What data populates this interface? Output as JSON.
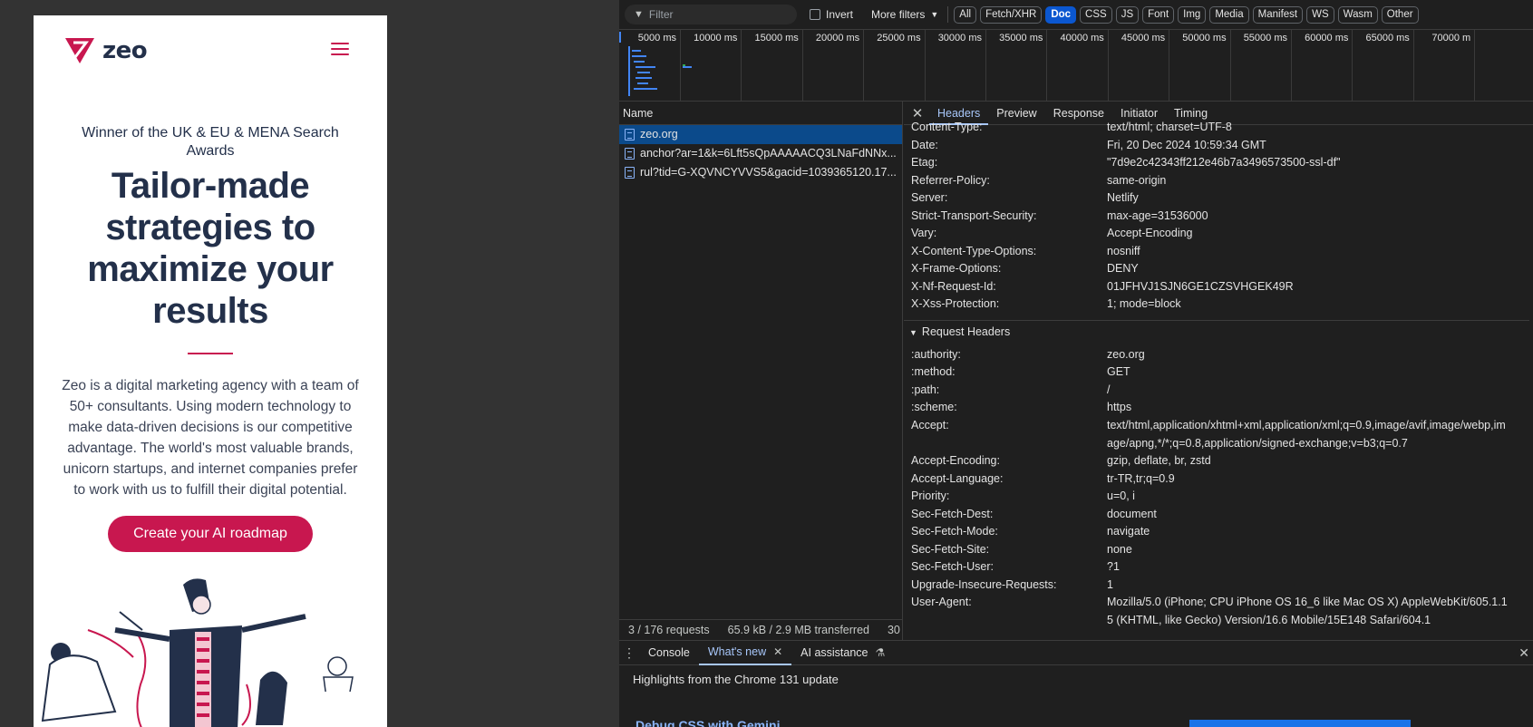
{
  "mobile": {
    "logo_text": "zeo",
    "award": "Winner of the UK & EU & MENA Search Awards",
    "headline": "Tailor-made strategies to maximize your results",
    "intro": "Zeo is a digital marketing agency with a team of 50+ consultants. Using modern technology to make data-driven decisions is our competitive advantage. The world's most valuable brands, unicorn startups, and internet companies prefer to work with us to fulfill their digital potential.",
    "cta_label": "Create your AI roadmap",
    "brand_color": "#c8174f",
    "text_color": "#23304a"
  },
  "devtools": {
    "toolbar": {
      "filter_placeholder": "Filter",
      "invert_label": "Invert",
      "more_filters_label": "More filters",
      "type_filters": [
        "All",
        "Fetch/XHR",
        "Doc",
        "CSS",
        "JS",
        "Font",
        "Img",
        "Media",
        "Manifest",
        "WS",
        "Wasm",
        "Other"
      ],
      "active_filter": "Doc"
    },
    "timeline_ticks": [
      "5000 ms",
      "10000 ms",
      "15000 ms",
      "20000 ms",
      "25000 ms",
      "30000 ms",
      "35000 ms",
      "40000 ms",
      "45000 ms",
      "50000 ms",
      "55000 ms",
      "60000 ms",
      "65000 ms",
      "70000 m"
    ],
    "name_column_header": "Name",
    "requests": [
      "zeo.org",
      "anchor?ar=1&k=6Lft5sQpAAAAACQ3LNaFdNNx...",
      "rul?tid=G-XQVNCYVVS5&gacid=1039365120.17..."
    ],
    "status_bar": {
      "requests": "3 / 176 requests",
      "transferred": "65.9 kB / 2.9 MB transferred",
      "extra": "30"
    },
    "detail_tabs": [
      "Headers",
      "Preview",
      "Response",
      "Initiator",
      "Timing"
    ],
    "active_detail_tab": "Headers",
    "response_headers": [
      {
        "key": "Content-Type:",
        "value": "text/html; charset=UTF-8"
      },
      {
        "key": "Date:",
        "value": "Fri, 20 Dec 2024 10:59:34 GMT"
      },
      {
        "key": "Etag:",
        "value": "\"7d9e2c42343ff212e46b7a3496573500-ssl-df\""
      },
      {
        "key": "Referrer-Policy:",
        "value": "same-origin"
      },
      {
        "key": "Server:",
        "value": "Netlify"
      },
      {
        "key": "Strict-Transport-Security:",
        "value": "max-age=31536000"
      },
      {
        "key": "Vary:",
        "value": "Accept-Encoding"
      },
      {
        "key": "X-Content-Type-Options:",
        "value": "nosniff"
      },
      {
        "key": "X-Frame-Options:",
        "value": "DENY"
      },
      {
        "key": "X-Nf-Request-Id:",
        "value": "01JFHVJ1SJN6GE1CZSVHGEK49R"
      },
      {
        "key": "X-Xss-Protection:",
        "value": "1; mode=block"
      }
    ],
    "request_headers_title": "Request Headers",
    "request_headers": [
      {
        "key": ":authority:",
        "value": "zeo.org"
      },
      {
        "key": ":method:",
        "value": "GET"
      },
      {
        "key": ":path:",
        "value": "/"
      },
      {
        "key": ":scheme:",
        "value": "https"
      },
      {
        "key": "Accept:",
        "value": "text/html,application/xhtml+xml,application/xml;q=0.9,image/avif,image/webp,image/apng,*/*;q=0.8,application/signed-exchange;v=b3;q=0.7"
      },
      {
        "key": "Accept-Encoding:",
        "value": "gzip, deflate, br, zstd"
      },
      {
        "key": "Accept-Language:",
        "value": "tr-TR,tr;q=0.9"
      },
      {
        "key": "Priority:",
        "value": "u=0, i"
      },
      {
        "key": "Sec-Fetch-Dest:",
        "value": "document"
      },
      {
        "key": "Sec-Fetch-Mode:",
        "value": "navigate"
      },
      {
        "key": "Sec-Fetch-Site:",
        "value": "none"
      },
      {
        "key": "Sec-Fetch-User:",
        "value": "?1"
      },
      {
        "key": "Upgrade-Insecure-Requests:",
        "value": "1"
      },
      {
        "key": "User-Agent:",
        "value": "Mozilla/5.0 (iPhone; CPU iPhone OS 16_6 like Mac OS X) AppleWebKit/605.1.15 (KHTML, like Gecko) Version/16.6 Mobile/15E148 Safari/604.1"
      }
    ],
    "drawer": {
      "tabs": [
        "Console",
        "What's new",
        "AI assistance"
      ],
      "active_tab": "What's new",
      "title": "Highlights from the Chrome 131 update",
      "link": "Debug CSS with Gemini"
    },
    "accent_color": "#a8c7fa"
  }
}
